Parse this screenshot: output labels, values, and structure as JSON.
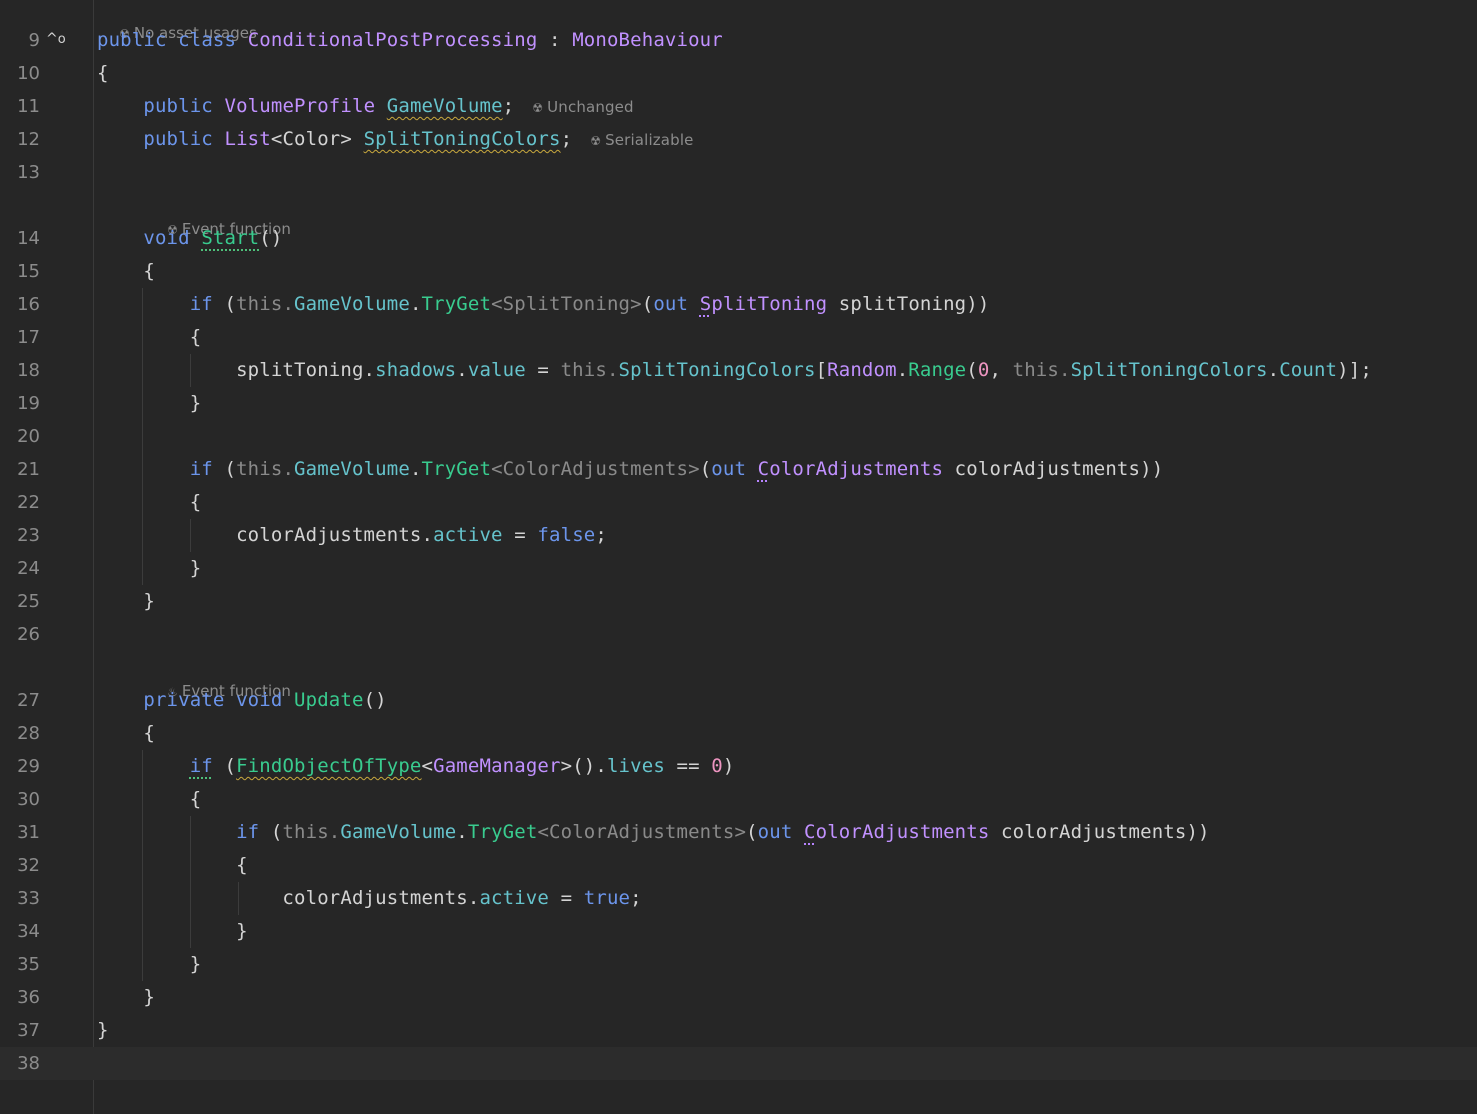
{
  "editor": {
    "top_hint": "No asset usages",
    "hints": {
      "unchanged": "Unchanged",
      "serializable": "Serializable",
      "event_function": "Event function"
    },
    "lines": [
      {
        "n": "9",
        "text": "public class ConditionalPostProcessing : MonoBehaviour"
      },
      {
        "n": "10",
        "text": "{"
      },
      {
        "n": "11",
        "text": "    public VolumeProfile GameVolume;"
      },
      {
        "n": "12",
        "text": "    public List<Color> SplitToningColors;"
      },
      {
        "n": "13",
        "text": ""
      },
      {
        "n": "14",
        "text": "    void Start()"
      },
      {
        "n": "15",
        "text": "    {"
      },
      {
        "n": "16",
        "text": "        if (this.GameVolume.TryGet<SplitToning>(out SplitToning splitToning))"
      },
      {
        "n": "17",
        "text": "        {"
      },
      {
        "n": "18",
        "text": "            splitToning.shadows.value = this.SplitToningColors[Random.Range(0, this.SplitToningColors.Count)];"
      },
      {
        "n": "19",
        "text": "        }"
      },
      {
        "n": "20",
        "text": ""
      },
      {
        "n": "21",
        "text": "        if (this.GameVolume.TryGet<ColorAdjustments>(out ColorAdjustments colorAdjustments))"
      },
      {
        "n": "22",
        "text": "        {"
      },
      {
        "n": "23",
        "text": "            colorAdjustments.active = false;"
      },
      {
        "n": "24",
        "text": "        }"
      },
      {
        "n": "25",
        "text": "    }"
      },
      {
        "n": "26",
        "text": ""
      },
      {
        "n": "27",
        "text": "    private void Update()"
      },
      {
        "n": "28",
        "text": "    {"
      },
      {
        "n": "29",
        "text": "        if (FindObjectOfType<GameManager>().lives == 0)"
      },
      {
        "n": "30",
        "text": "        {"
      },
      {
        "n": "31",
        "text": "            if (this.GameVolume.TryGet<ColorAdjustments>(out ColorAdjustments colorAdjustments))"
      },
      {
        "n": "32",
        "text": "            {"
      },
      {
        "n": "33",
        "text": "                colorAdjustments.active = true;"
      },
      {
        "n": "34",
        "text": "            }"
      },
      {
        "n": "35",
        "text": "        }"
      },
      {
        "n": "36",
        "text": "    }"
      },
      {
        "n": "37",
        "text": "}"
      },
      {
        "n": "38",
        "text": ""
      }
    ]
  },
  "colors": {
    "background": "#262626",
    "keyword": "#6c95eb",
    "class": "#c191ff",
    "method": "#39cc8f",
    "field": "#66c3cc",
    "number": "#ed94c0",
    "text": "#d4d4d4",
    "gutter_number": "#8c8c8c"
  },
  "icons": {
    "unity_hint": "unity-icon",
    "override_gutter": "implements-override-icon",
    "hot_method": "flame-icon"
  }
}
